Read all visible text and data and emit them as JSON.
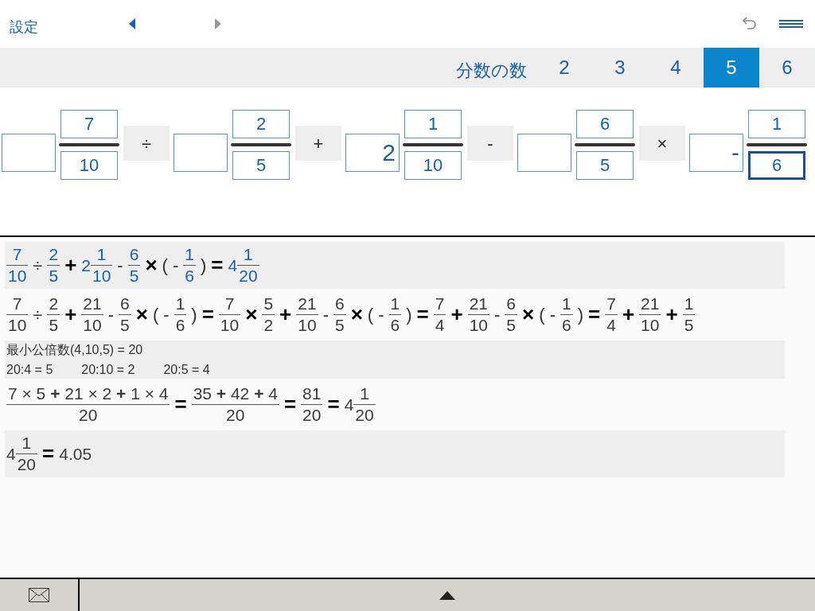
{
  "toolbar": {
    "settings": "設定",
    "nav": [
      {
        "kind": "prev",
        "disabled": false
      },
      {
        "kind": "next",
        "disabled": true
      }
    ]
  },
  "fraction_count": {
    "label": "分数の数",
    "options": [
      {
        "label": "2",
        "selected": false
      },
      {
        "label": "3",
        "selected": false
      },
      {
        "label": "4",
        "selected": false
      },
      {
        "label": "5",
        "selected": true
      },
      {
        "label": "6",
        "selected": false
      }
    ]
  },
  "operands": [
    {
      "whole": {
        "focused": false
      },
      "numerator": {
        "value": "7",
        "focused": false
      },
      "denominator": {
        "value": "10",
        "focused": false
      }
    },
    {
      "whole": {
        "focused": false
      },
      "numerator": {
        "value": "2",
        "focused": false
      },
      "denominator": {
        "value": "5",
        "focused": false
      }
    },
    {
      "whole": {
        "value": "2",
        "focused": false
      },
      "numerator": {
        "value": "1",
        "focused": false
      },
      "denominator": {
        "value": "10",
        "focused": false
      }
    },
    {
      "whole": {
        "focused": false
      },
      "numerator": {
        "value": "6",
        "focused": false
      },
      "denominator": {
        "value": "5",
        "focused": false
      }
    },
    {
      "whole": {
        "value": "-",
        "focused": false
      },
      "numerator": {
        "value": "1",
        "focused": false
      },
      "denominator": {
        "value": "6",
        "focused": true
      }
    }
  ],
  "operators": [
    "÷",
    "+",
    "-",
    "×"
  ],
  "solution": [
    {
      "kind": "echo",
      "tokens": [
        {
          "kind": "frac",
          "num": "7",
          "den": "10"
        },
        {
          "kind": "sym",
          "text": "÷"
        },
        {
          "kind": "frac",
          "num": "2",
          "den": "5"
        },
        {
          "kind": "op",
          "text": "+"
        },
        {
          "kind": "mixed",
          "whole": "2",
          "num": "1",
          "den": "10"
        },
        {
          "kind": "sym",
          "text": "-"
        },
        {
          "kind": "frac",
          "num": "6",
          "den": "5"
        },
        {
          "kind": "op",
          "text": "×"
        },
        {
          "kind": "sym",
          "text": "( -"
        },
        {
          "kind": "frac",
          "num": "1",
          "den": "6"
        },
        {
          "kind": "sym",
          "text": ")"
        },
        {
          "kind": "op",
          "text": "="
        },
        {
          "kind": "mixed",
          "whole": "4",
          "num": "1",
          "den": "20"
        }
      ]
    },
    {
      "kind": "step",
      "tokens": [
        {
          "kind": "frac",
          "num": "7",
          "den": "10"
        },
        {
          "kind": "sym",
          "text": "÷"
        },
        {
          "kind": "frac",
          "num": "2",
          "den": "5"
        },
        {
          "kind": "op",
          "text": "+"
        },
        {
          "kind": "frac",
          "num": "21",
          "den": "10"
        },
        {
          "kind": "sym",
          "text": "-"
        },
        {
          "kind": "frac",
          "num": "6",
          "den": "5"
        },
        {
          "kind": "op",
          "text": "×"
        },
        {
          "kind": "sym",
          "text": "( -"
        },
        {
          "kind": "frac",
          "num": "1",
          "den": "6"
        },
        {
          "kind": "sym",
          "text": ")"
        },
        {
          "kind": "op",
          "text": "="
        },
        {
          "kind": "frac",
          "num": "7",
          "den": "10"
        },
        {
          "kind": "op",
          "text": "×"
        },
        {
          "kind": "frac",
          "num": "5",
          "den": "2"
        },
        {
          "kind": "op",
          "text": "+"
        },
        {
          "kind": "frac",
          "num": "21",
          "den": "10"
        },
        {
          "kind": "sym",
          "text": "-"
        },
        {
          "kind": "frac",
          "num": "6",
          "den": "5"
        },
        {
          "kind": "op",
          "text": "×"
        },
        {
          "kind": "sym",
          "text": "( -"
        },
        {
          "kind": "frac",
          "num": "1",
          "den": "6"
        },
        {
          "kind": "sym",
          "text": ")"
        },
        {
          "kind": "op",
          "text": "="
        },
        {
          "kind": "frac",
          "num": "7",
          "den": "4"
        },
        {
          "kind": "op",
          "text": "+"
        },
        {
          "kind": "frac",
          "num": "21",
          "den": "10"
        },
        {
          "kind": "sym",
          "text": "-"
        },
        {
          "kind": "frac",
          "num": "6",
          "den": "5"
        },
        {
          "kind": "op",
          "text": "×"
        },
        {
          "kind": "sym",
          "text": "( -"
        },
        {
          "kind": "frac",
          "num": "1",
          "den": "6"
        },
        {
          "kind": "sym",
          "text": ")"
        },
        {
          "kind": "op",
          "text": "="
        },
        {
          "kind": "frac",
          "num": "7",
          "den": "4"
        },
        {
          "kind": "op",
          "text": "+"
        },
        {
          "kind": "frac",
          "num": "21",
          "den": "10"
        },
        {
          "kind": "op",
          "text": "+"
        },
        {
          "kind": "frac",
          "num": "1",
          "den": "5"
        }
      ]
    },
    {
      "kind": "text",
      "rows": [
        [
          "最小公倍数(4,10,5) = 20"
        ],
        [
          "20:4 = 5",
          "20:10 = 2",
          "20:5 = 4"
        ]
      ]
    },
    {
      "kind": "step",
      "tokens": [
        {
          "kind": "frac",
          "num": "7 × 5 **+** 21 × 2 **+** 1 × 4",
          "den": "20"
        },
        {
          "kind": "op",
          "text": "="
        },
        {
          "kind": "frac",
          "num": "35 **+** 42 **+** 4",
          "den": "20"
        },
        {
          "kind": "op",
          "text": "="
        },
        {
          "kind": "frac",
          "num": "81",
          "den": "20"
        },
        {
          "kind": "op",
          "text": "="
        },
        {
          "kind": "mixed",
          "whole": "4",
          "num": "1",
          "den": "20"
        }
      ]
    },
    {
      "kind": "step",
      "tokens": [
        {
          "kind": "mixed",
          "whole": "4",
          "num": "1",
          "den": "20"
        },
        {
          "kind": "op",
          "text": "="
        },
        {
          "kind": "num",
          "text": "4.05"
        }
      ]
    }
  ]
}
